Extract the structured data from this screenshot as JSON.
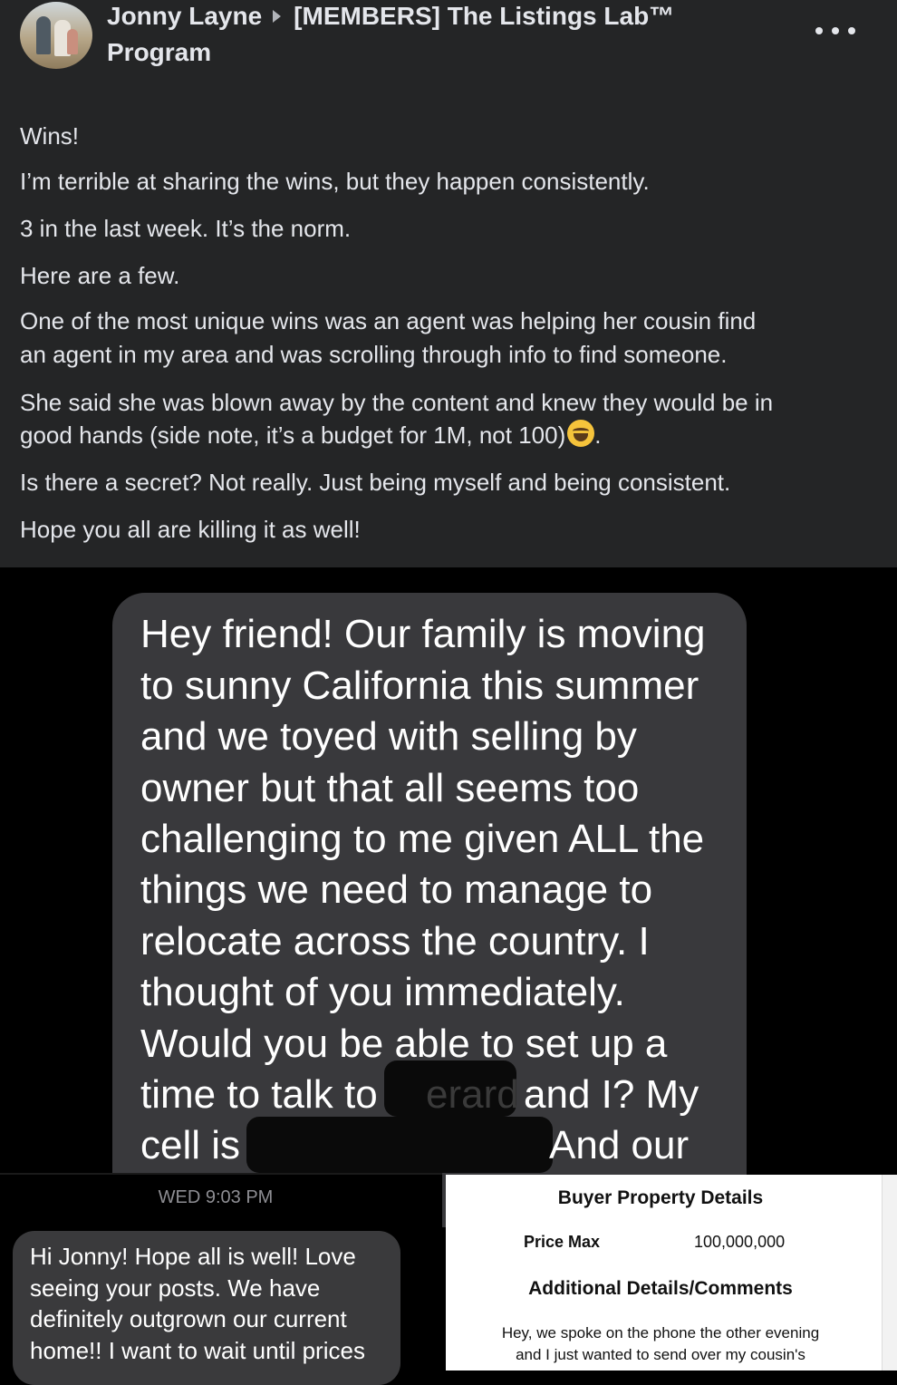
{
  "post": {
    "author": "Jonny Layne",
    "group_line1": "[MEMBERS] The Listings Lab™",
    "group_line2": "Program",
    "paragraphs": [
      "Wins!",
      "I’m terrible at sharing the wins, but they happen consistently.",
      "3 in the last week. It’s the norm.",
      "Here are a few.",
      "One of the most unique wins was an agent was helping her cousin find",
      "an agent in my area and was scrolling through info to find someone.",
      "She said she was blown away by the content and knew they would be in",
      "good hands (side note, it’s a budget for 1M, not 100)",
      "Is there a secret? Not really. Just being myself and being consistent.",
      "Hope you all are killing it as well!"
    ],
    "emoji_icon": "laughing-crying-emoji"
  },
  "message1": {
    "lines": [
      "Hey friend!  Our family is moving",
      "to sunny California this summer",
      "and we toyed with selling by",
      "owner but that all seems too",
      "challenging to me given ALL the",
      "things we need to manage to",
      "relocate across the country.  I",
      "thought of you immediately.",
      "Would you be able to set up a",
      "time to talk to",
      "and I?  My",
      "cell is",
      "And our"
    ],
    "blurred_name": "erard"
  },
  "message2": {
    "timestamp": "WED 9:03 PM",
    "lines": [
      "Hi Jonny! Hope all is well! Love",
      "seeing your posts. We have",
      "definitely outgrown our current",
      "home!! I want to wait until prices"
    ]
  },
  "form": {
    "title": "Buyer Property Details",
    "price_label": "Price Max",
    "price_value": "100,000,000",
    "subtitle": "Additional Details/Comments",
    "text_line1": "Hey, we spoke on the phone the other evening",
    "text_line2": "and I just wanted to send over my cousin's"
  },
  "colors": {
    "post_bg": "#242526",
    "bubble_gray": "#39393c",
    "text_light": "#e4e6eb"
  }
}
